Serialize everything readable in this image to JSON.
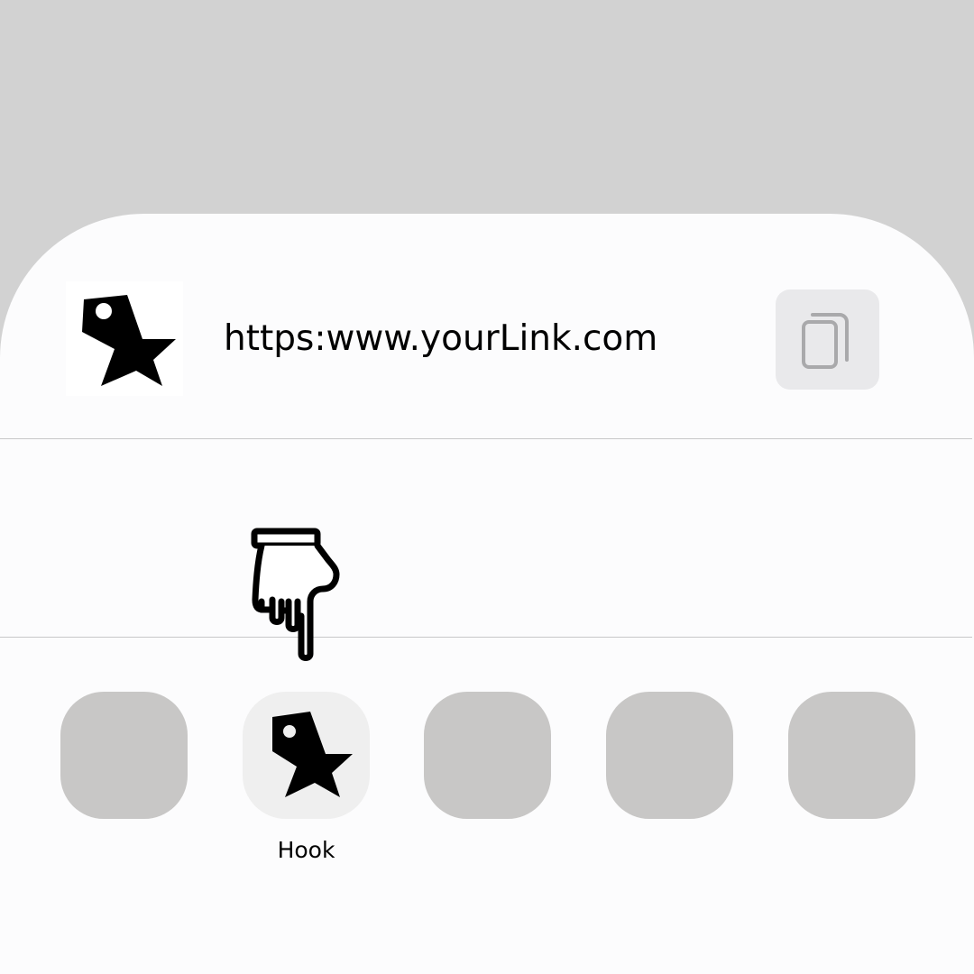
{
  "share_sheet": {
    "link": {
      "url": "https:www.yourLink.com",
      "app_icon": "star-tag-logo-icon",
      "copy_icon": "copy-icon"
    },
    "pointer_icon": "pointing-hand-icon",
    "apps": [
      {
        "label": "",
        "icon": "placeholder"
      },
      {
        "label": "Hook",
        "icon": "star-tag-logo-icon"
      },
      {
        "label": "",
        "icon": "placeholder"
      },
      {
        "label": "",
        "icon": "placeholder"
      },
      {
        "label": "",
        "icon": "placeholder"
      }
    ]
  },
  "colors": {
    "backdrop": "#d2d2d2",
    "sheet": "#fcfcfd",
    "placeholder_app": "#c8c7c6",
    "selected_app": "#efefef",
    "copy_button": "#e9e9eb",
    "divider": "#c8c8c8"
  }
}
